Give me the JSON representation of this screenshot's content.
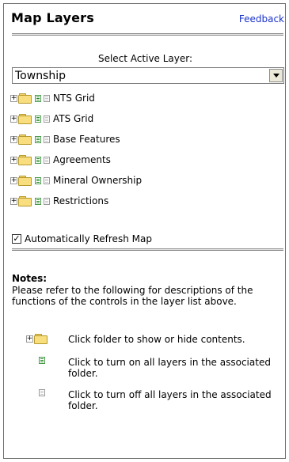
{
  "panel": {
    "title": "Map Layers",
    "feedback_label": "Feedback",
    "select_label": "Select Active Layer:",
    "select_value": "Township",
    "layers": [
      {
        "label": "NTS Grid"
      },
      {
        "label": "ATS Grid"
      },
      {
        "label": "Base Features"
      },
      {
        "label": "Agreements"
      },
      {
        "label": "Mineral Ownership"
      },
      {
        "label": "Restrictions"
      }
    ],
    "auto_refresh": {
      "label": "Automatically Refresh Map",
      "checked": true
    },
    "notes": {
      "title": "Notes:",
      "text": "Please refer to the following for descriptions of the functions of the controls in the layer list above.",
      "legend": [
        {
          "icon": "plus-folder-icon",
          "text": "Click folder to show or hide contents."
        },
        {
          "icon": "layers-on-icon",
          "text": "Click to turn on all layers in the associated folder."
        },
        {
          "icon": "layers-off-icon",
          "text": "Click to turn off all layers in the associated folder."
        }
      ]
    }
  },
  "colors": {
    "link": "#1a33cc",
    "folder": "#f8de7e",
    "on_icon": "#2e8b2e",
    "border": "#6f6f6f"
  }
}
